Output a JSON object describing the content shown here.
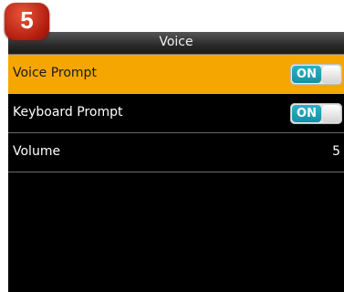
{
  "step_badge": {
    "number": "5"
  },
  "header": {
    "title": "Voice"
  },
  "settings": [
    {
      "label": "Voice Prompt",
      "type": "toggle",
      "state": "ON",
      "selected": true
    },
    {
      "label": "Keyboard Prompt",
      "type": "toggle",
      "state": "ON",
      "selected": false
    },
    {
      "label": "Volume",
      "type": "value",
      "value": "5",
      "selected": false
    }
  ],
  "colors": {
    "selection": "#f5a600",
    "toggle_on": "#1ea2b6",
    "background": "#000000",
    "badge": "#c9281a"
  }
}
